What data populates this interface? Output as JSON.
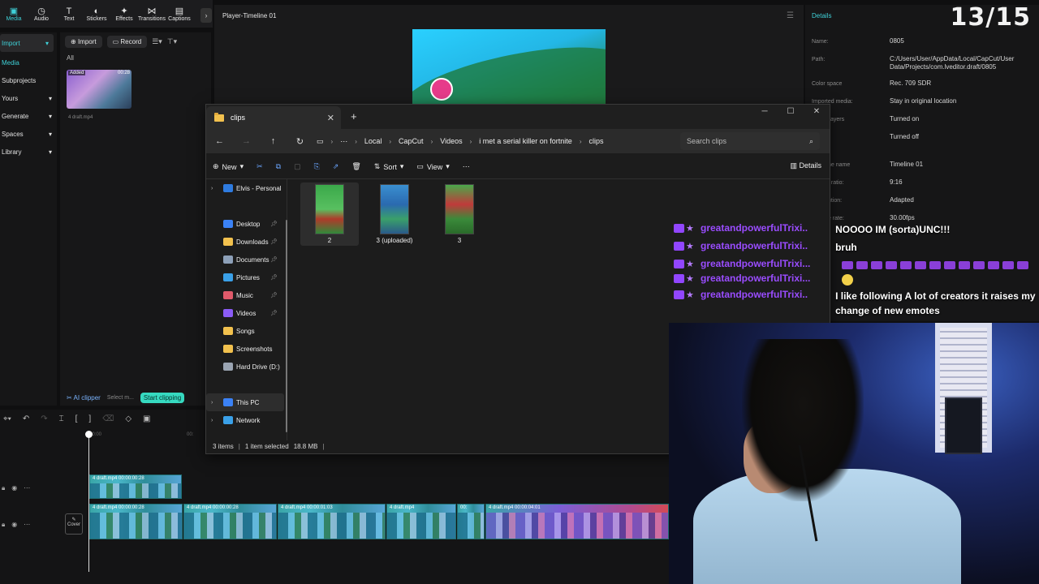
{
  "capcut": {
    "toolbar": [
      {
        "label": "Media",
        "icon": "media-icon"
      },
      {
        "label": "Audio",
        "icon": "audio-icon"
      },
      {
        "label": "Text",
        "icon": "text-icon"
      },
      {
        "label": "Stickers",
        "icon": "stickers-icon"
      },
      {
        "label": "Effects",
        "icon": "effects-icon"
      },
      {
        "label": "Transitions",
        "icon": "transitions-icon"
      },
      {
        "label": "Captions",
        "icon": "captions-icon"
      }
    ],
    "sidebar": {
      "items": [
        {
          "label": "Import",
          "chevron": "▾"
        },
        {
          "label": "Media",
          "chevron": ""
        },
        {
          "label": "Subprojects",
          "chevron": ""
        },
        {
          "label": "Yours",
          "chevron": "▾"
        },
        {
          "label": "Generate",
          "chevron": "▾"
        },
        {
          "label": "Spaces",
          "chevron": "▾"
        },
        {
          "label": "Library",
          "chevron": "▾"
        }
      ]
    },
    "media": {
      "import_label": "Import",
      "record_label": "Record",
      "all_label": "All",
      "thumb_tag": "Added",
      "thumb_duration": "00:28",
      "thumb_name": "4 draft.mp4"
    },
    "ai": {
      "clipper_label": "AI clipper",
      "select_label": "Select m...",
      "start_label": "Start clipping"
    },
    "player": {
      "title": "Player-Timeline 01"
    },
    "details": {
      "title": "Details",
      "rows": [
        {
          "label": "Name:",
          "value": "0805"
        },
        {
          "label": "Path:",
          "value": "C:/Users/User/AppData/Local/CapCut/User Data/Projects/com.lveditor.draft/0805"
        },
        {
          "label": "Color space",
          "value": "Rec. 709 SDR"
        },
        {
          "label": "Imported media:",
          "value": "Stay in original location"
        },
        {
          "label": "Image layers",
          "value": "Turned on"
        },
        {
          "label": "",
          "value": "Turned off"
        },
        {
          "label": "ne name",
          "value": "Timeline 01"
        },
        {
          "label": "t ratio:",
          "value": "9:16"
        },
        {
          "label": "ution:",
          "value": "Adapted"
        },
        {
          "label": "e rate:",
          "value": "30.00fps"
        }
      ]
    },
    "timeline": {
      "ruler_start": "00:00",
      "ruler_mid": "00:",
      "clip_top": "4 draft.mp4   00:00:00:28",
      "clips": [
        "4 draft.mp4   00:00:00:28",
        "4 draft.mp4   00:00:01:03",
        "4 draft.mp4",
        "00:",
        "4 draft.mp4   00:00:04:01"
      ],
      "cover_label": "Cover"
    }
  },
  "counter": "13/15",
  "explorer": {
    "tab_title": "clips",
    "breadcrumbs": [
      "Local",
      "CapCut",
      "Videos",
      "i met a serial killer on fortnite",
      "clips"
    ],
    "search_placeholder": "Search clips",
    "commands": {
      "new": "New",
      "sort": "Sort",
      "view": "View",
      "details": "Details"
    },
    "nav": [
      {
        "label": "Elvis - Personal",
        "color": "#2e7be0"
      },
      {
        "label": "Desktop",
        "color": "#3b82f6"
      },
      {
        "label": "Downloads",
        "color": "#f2c14e"
      },
      {
        "label": "Documents",
        "color": "#8da0b8"
      },
      {
        "label": "Pictures",
        "color": "#3aa0e8"
      },
      {
        "label": "Music",
        "color": "#e05a6a"
      },
      {
        "label": "Videos",
        "color": "#8b5cf6"
      },
      {
        "label": "Songs",
        "color": "#f2c14e"
      },
      {
        "label": "Screenshots",
        "color": "#f2c14e"
      },
      {
        "label": "Hard Drive (D:)",
        "color": "#9aa4b2"
      },
      {
        "label": "This PC",
        "color": "#3b82f6"
      },
      {
        "label": "Network",
        "color": "#3aa0e8"
      }
    ],
    "files": [
      {
        "name": "2",
        "selected": true
      },
      {
        "name": "3 (uploaded)",
        "selected": false
      },
      {
        "name": "3",
        "selected": false
      }
    ],
    "status": {
      "count": "3 items",
      "selected": "1 item selected",
      "size": "18.8 MB"
    }
  },
  "chat": [
    {
      "user": "greatandpowerfulTrixi...",
      "text": "NOOOO IM (sorta)UNC!!!"
    },
    {
      "user": "greatandpowerfulTrixi...",
      "text": "bruh"
    },
    {
      "user": "greatandpowerfulTrixi...",
      "text": ""
    },
    {
      "user": "greatandpowerfulTrixi...",
      "text": ""
    },
    {
      "user": "greatandpowerfulTrixi...",
      "text": "I like following A lot of creators it raises my change of new emotes"
    }
  ]
}
